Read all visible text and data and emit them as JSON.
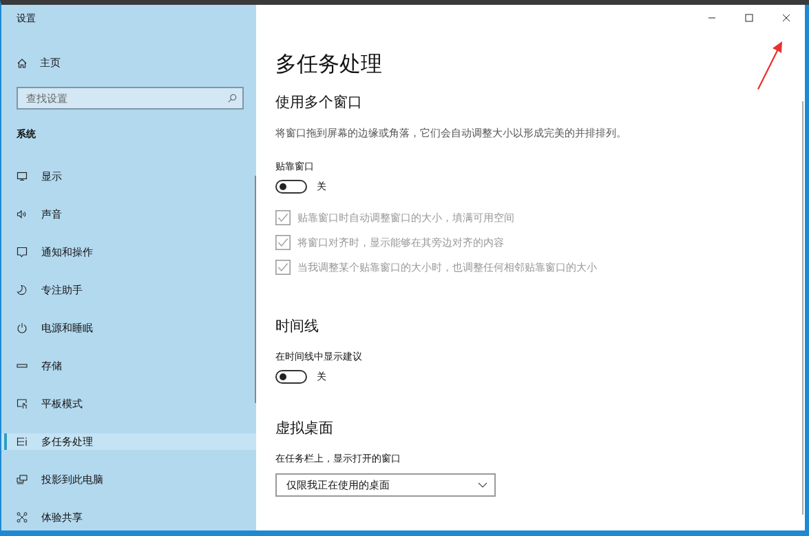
{
  "window": {
    "title": "设置"
  },
  "sidebar": {
    "home": "主页",
    "search": {
      "placeholder": "查找设置"
    },
    "section": "系统",
    "items": [
      {
        "label": "显示",
        "selected": false
      },
      {
        "label": "声音",
        "selected": false
      },
      {
        "label": "通知和操作",
        "selected": false
      },
      {
        "label": "专注助手",
        "selected": false
      },
      {
        "label": "电源和睡眠",
        "selected": false
      },
      {
        "label": "存储",
        "selected": false
      },
      {
        "label": "平板模式",
        "selected": false
      },
      {
        "label": "多任务处理",
        "selected": true
      },
      {
        "label": "投影到此电脑",
        "selected": false
      },
      {
        "label": "体验共享",
        "selected": false
      }
    ]
  },
  "main": {
    "title": "多任务处理",
    "sections": [
      {
        "heading": "使用多个窗口",
        "description": "将窗口拖到屏幕的边缘或角落，它们会自动调整大小以形成完美的并排排列。",
        "settings": [
          {
            "kind": "toggle",
            "label": "贴靠窗口",
            "on": false,
            "state_text": "关"
          },
          {
            "kind": "checkbox",
            "label": "贴靠窗口时自动调整窗口的大小，填满可用空间",
            "checked": true,
            "disabled": true
          },
          {
            "kind": "checkbox",
            "label": "将窗口对齐时，显示能够在其旁边对齐的内容",
            "checked": true,
            "disabled": true
          },
          {
            "kind": "checkbox",
            "label": "当我调整某个贴靠窗口的大小时，也调整任何相邻贴靠窗口的大小",
            "checked": true,
            "disabled": true
          }
        ]
      },
      {
        "heading": "时间线",
        "settings": [
          {
            "kind": "toggle",
            "label": "在时间线中显示建议",
            "on": false,
            "state_text": "关"
          }
        ]
      },
      {
        "heading": "虚拟桌面",
        "settings": [
          {
            "kind": "dropdown",
            "label": "在任务栏上，显示打开的窗口",
            "value": "仅限我正在使用的桌面"
          }
        ]
      }
    ]
  }
}
